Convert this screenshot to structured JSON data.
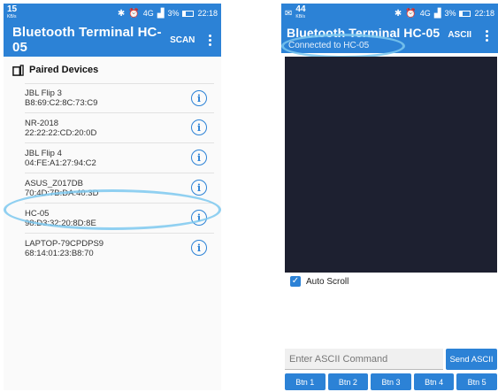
{
  "left": {
    "status": {
      "time_small": "15",
      "time_small_unit": "KB/s",
      "signal": "4G",
      "battery": "3%",
      "clock": "22:18"
    },
    "appbar": {
      "title": "Bluetooth Terminal HC-05",
      "action": "SCAN"
    },
    "section_title": "Paired Devices",
    "devices": [
      {
        "name": "JBL Flip 3",
        "address": "B8:69:C2:8C:73:C9"
      },
      {
        "name": "NR-2018",
        "address": "22:22:22:CD:20:0D"
      },
      {
        "name": "JBL Flip 4",
        "address": "04:FE:A1:27:94:C2"
      },
      {
        "name": "ASUS_Z017DB",
        "address": "70:4D:7B:DA:40:3D"
      },
      {
        "name": "HC-05",
        "address": "98:D3:32:20:8D:8E"
      },
      {
        "name": "LAPTOP-79CPDPS9",
        "address": "68:14:01:23:B8:70"
      }
    ]
  },
  "right": {
    "status": {
      "time_small": "44",
      "time_small_unit": "KB/s",
      "signal": "4G",
      "battery": "3%",
      "clock": "22:18"
    },
    "appbar": {
      "title": "Bluetooth Terminal HC-05",
      "subtitle": "Connected to HC-05",
      "action": "ASCII"
    },
    "autoscroll_label": "Auto Scroll",
    "input_placeholder": "Enter ASCII Command",
    "send_label": "Send ASCII",
    "macro_buttons": [
      "Btn 1",
      "Btn 2",
      "Btn 3",
      "Btn 4",
      "Btn 5"
    ]
  },
  "colors": {
    "accent": "#2c82d6",
    "terminal_bg": "#1d2030",
    "highlight": "#7cc8ee"
  }
}
